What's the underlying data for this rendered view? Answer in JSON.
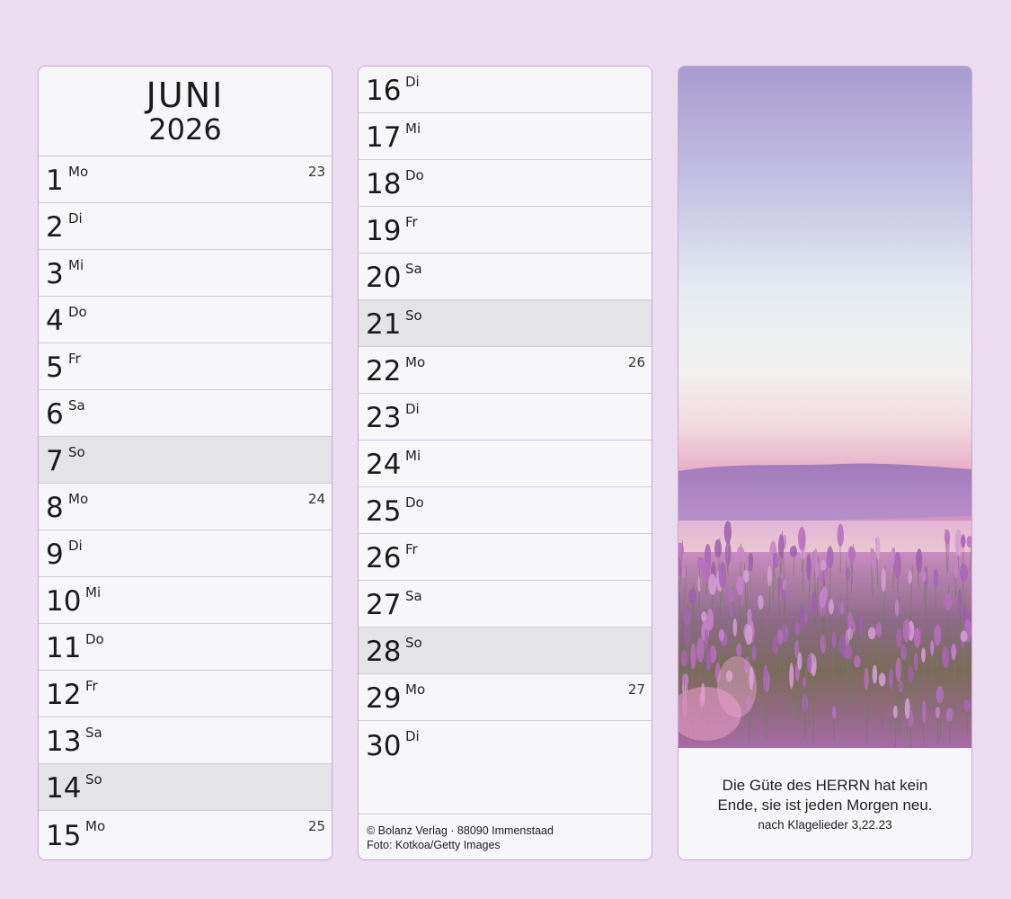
{
  "header": {
    "month": "JUNI",
    "year": "2026"
  },
  "column1": [
    {
      "day": "1",
      "name": "Mo",
      "week": "23",
      "sunday": false
    },
    {
      "day": "2",
      "name": "Di",
      "week": "",
      "sunday": false
    },
    {
      "day": "3",
      "name": "Mi",
      "week": "",
      "sunday": false
    },
    {
      "day": "4",
      "name": "Do",
      "week": "",
      "sunday": false
    },
    {
      "day": "5",
      "name": "Fr",
      "week": "",
      "sunday": false
    },
    {
      "day": "6",
      "name": "Sa",
      "week": "",
      "sunday": false
    },
    {
      "day": "7",
      "name": "So",
      "week": "",
      "sunday": true
    },
    {
      "day": "8",
      "name": "Mo",
      "week": "24",
      "sunday": false
    },
    {
      "day": "9",
      "name": "Di",
      "week": "",
      "sunday": false
    },
    {
      "day": "10",
      "name": "Mi",
      "week": "",
      "sunday": false
    },
    {
      "day": "11",
      "name": "Do",
      "week": "",
      "sunday": false
    },
    {
      "day": "12",
      "name": "Fr",
      "week": "",
      "sunday": false
    },
    {
      "day": "13",
      "name": "Sa",
      "week": "",
      "sunday": false
    },
    {
      "day": "14",
      "name": "So",
      "week": "",
      "sunday": true
    },
    {
      "day": "15",
      "name": "Mo",
      "week": "25",
      "sunday": false
    }
  ],
  "column2": [
    {
      "day": "16",
      "name": "Di",
      "week": "",
      "sunday": false
    },
    {
      "day": "17",
      "name": "Mi",
      "week": "",
      "sunday": false
    },
    {
      "day": "18",
      "name": "Do",
      "week": "",
      "sunday": false
    },
    {
      "day": "19",
      "name": "Fr",
      "week": "",
      "sunday": false
    },
    {
      "day": "20",
      "name": "Sa",
      "week": "",
      "sunday": false
    },
    {
      "day": "21",
      "name": "So",
      "week": "",
      "sunday": true
    },
    {
      "day": "22",
      "name": "Mo",
      "week": "26",
      "sunday": false
    },
    {
      "day": "23",
      "name": "Di",
      "week": "",
      "sunday": false
    },
    {
      "day": "24",
      "name": "Mi",
      "week": "",
      "sunday": false
    },
    {
      "day": "25",
      "name": "Do",
      "week": "",
      "sunday": false
    },
    {
      "day": "26",
      "name": "Fr",
      "week": "",
      "sunday": false
    },
    {
      "day": "27",
      "name": "Sa",
      "week": "",
      "sunday": false
    },
    {
      "day": "28",
      "name": "So",
      "week": "",
      "sunday": true
    },
    {
      "day": "29",
      "name": "Mo",
      "week": "27",
      "sunday": false
    },
    {
      "day": "30",
      "name": "Di",
      "week": "",
      "sunday": false
    }
  ],
  "credits": {
    "publisher": "© Bolanz Verlag · 88090 Immenstaad",
    "photo": "Foto: Kotkoa/Getty Images"
  },
  "quote": {
    "line1": "Die Güte des HERRN hat kein",
    "line2": "Ende, sie ist jeden Morgen neu.",
    "source": "nach Klagelieder 3,22.23"
  },
  "photo_subject": "lavender-field-at-sunset",
  "colors": {
    "background": "#ecdcf0",
    "panel": "#f7f6f8",
    "sunday_row": "#e4e3e6",
    "border": "#c9a9d2"
  }
}
